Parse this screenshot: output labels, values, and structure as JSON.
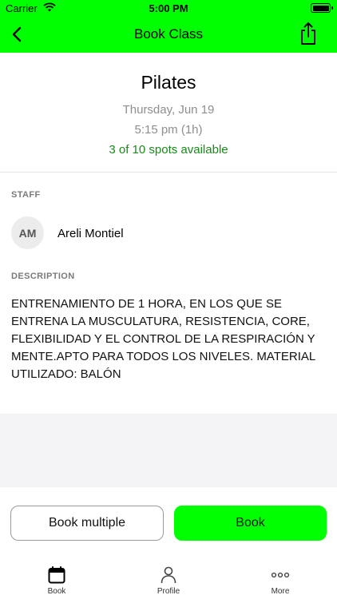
{
  "status_bar": {
    "carrier": "Carrier",
    "time": "5:00 PM"
  },
  "nav": {
    "title": "Book Class",
    "back_icon": "chevron-left-icon",
    "share_icon": "share-icon"
  },
  "class_info": {
    "name": "Pilates",
    "date": "Thursday, Jun 19",
    "time": "5:15 pm (1h)",
    "spots": "3 of 10 spots available"
  },
  "staff": {
    "label": "STAFF",
    "initials": "AM",
    "name": "Areli Montiel"
  },
  "description": {
    "label": "DESCRIPTION",
    "text": "ENTRENAMIENTO DE 1 HORA, EN LOS QUE SE ENTRENA LA MUSCULATURA, RESISTENCIA, CORE, FLEXIBILIDAD Y EL CONTROL DE LA RESPIRACIÓN Y MENTE.APTO PARA TODOS LOS NIVELES. MATERIAL UTILIZADO:  BALÓN"
  },
  "actions": {
    "book_multiple": "Book multiple",
    "book": "Book"
  },
  "tabs": [
    {
      "label": "Book",
      "icon": "calendar-icon"
    },
    {
      "label": "Profile",
      "icon": "person-icon"
    },
    {
      "label": "More",
      "icon": "ellipsis-icon"
    }
  ],
  "colors": {
    "accent": "#00ff00",
    "spots_text": "#1a8a1a"
  }
}
